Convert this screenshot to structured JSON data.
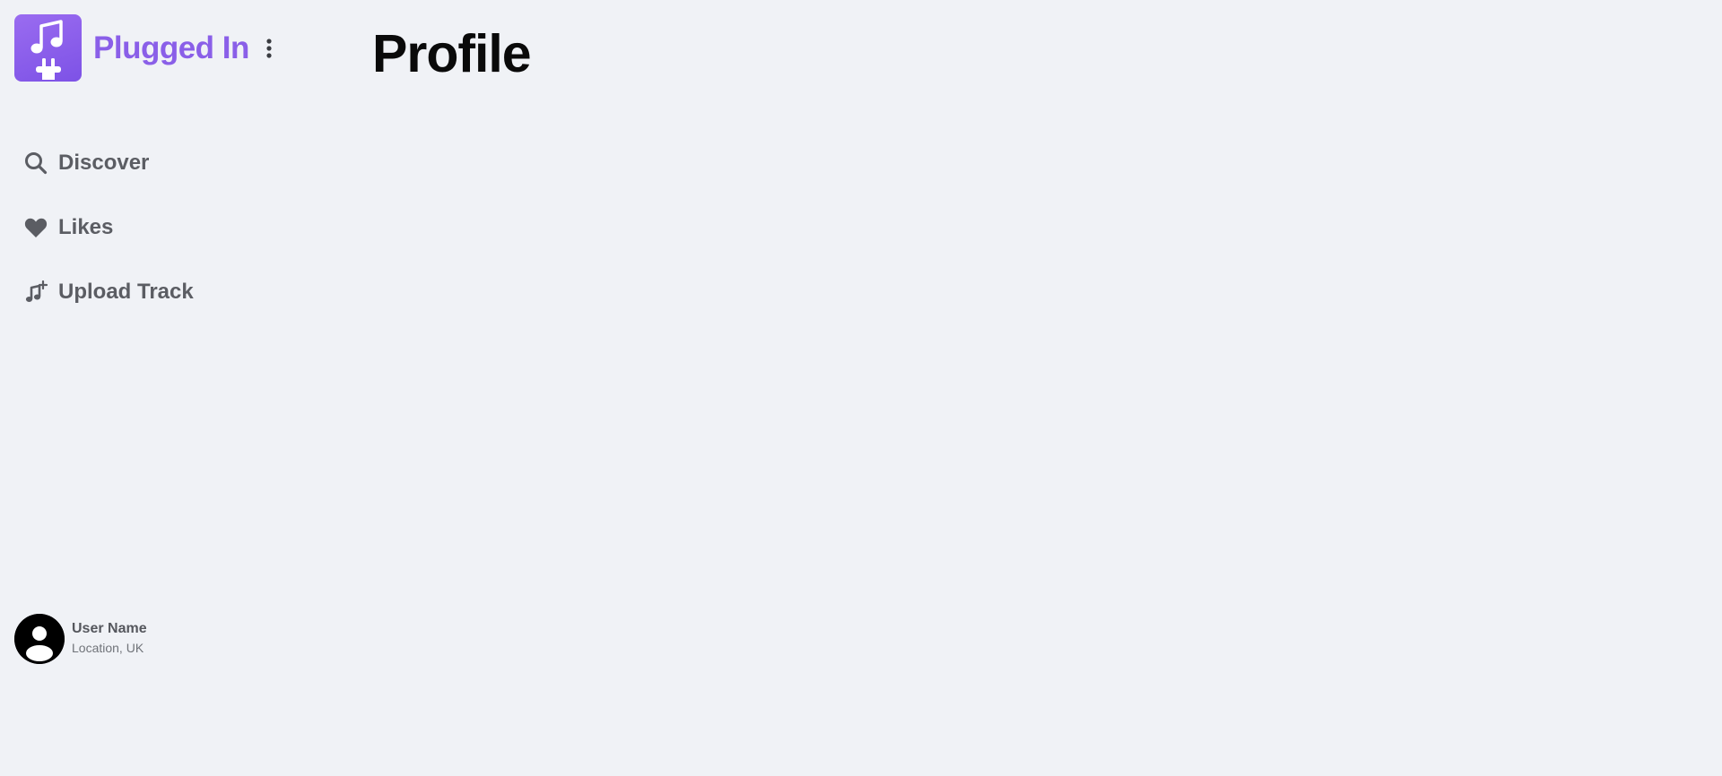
{
  "brand": {
    "name": "Plugged In",
    "logo_icon": "music-note-plug-icon",
    "menu_icon": "vertical-ellipsis-icon",
    "accent_color": "#8a5fe8"
  },
  "nav": {
    "items": [
      {
        "label": "Discover",
        "icon": "search-icon"
      },
      {
        "label": "Likes",
        "icon": "heart-icon"
      },
      {
        "label": "Upload Track",
        "icon": "music-note-plus-icon"
      }
    ]
  },
  "user": {
    "name": "User Name",
    "location": "Location, UK",
    "avatar_icon": "user-avatar-icon"
  },
  "main": {
    "title": "Profile"
  }
}
